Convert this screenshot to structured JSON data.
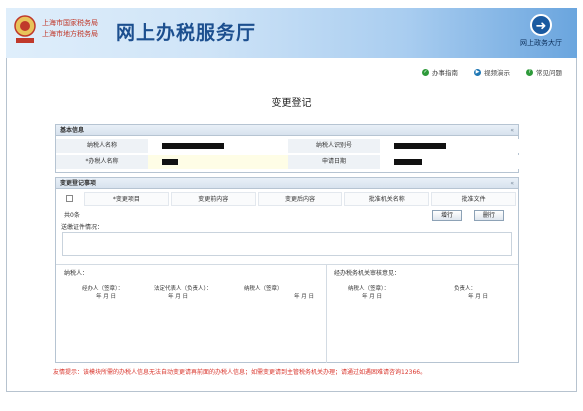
{
  "header": {
    "org_line_1": "上海市国家税务局",
    "org_line_2": "上海市地方税务局",
    "site_title": "网上办税服务厅",
    "portal_label": "网上政务大厅",
    "portal_icon": "login-arrow-icon"
  },
  "toolbar": {
    "items": [
      {
        "label": "办事指南",
        "icon": "guide-icon",
        "color": "#2e9a3a"
      },
      {
        "label": "视频演示",
        "icon": "video-icon",
        "color": "#1f77b4"
      },
      {
        "label": "常见问题",
        "icon": "help-icon",
        "color": "#2e9a3a"
      }
    ]
  },
  "page": {
    "title": "变更登记"
  },
  "basic_info": {
    "heading": "基本信息",
    "toggle": "«",
    "taxpayer_name_label": "纳税人名称",
    "taxpayer_id_label": "纳税人识别号",
    "handler_label": "*办税人名称",
    "apply_date_label": "申请日期"
  },
  "change_items": {
    "heading": "变更登记事项",
    "toggle": "«",
    "columns": [
      "*变更项目",
      "变更前内容",
      "变更后内容",
      "批准机关名称",
      "批准文件"
    ],
    "count_text": "共0条",
    "add_button": "增行",
    "delete_button": "删行",
    "docs_label": "送缴证件情况：",
    "sign_taxpayer": "纳税人：",
    "sign_authority": "经办税务机关审核意见：",
    "sig_items": [
      "经办人（签章）：",
      "法定代表人（负责人）：",
      "纳税人（签章）",
      "纳税人（签章）：",
      "负责人："
    ],
    "date_text": "年  月  日"
  },
  "warning": "友情提示：该模块所需的办税人信息无法自动变更请再前面的办税人信息；如需变更请到主管税务机关办理；请通过如遇困难请咨询12366。"
}
